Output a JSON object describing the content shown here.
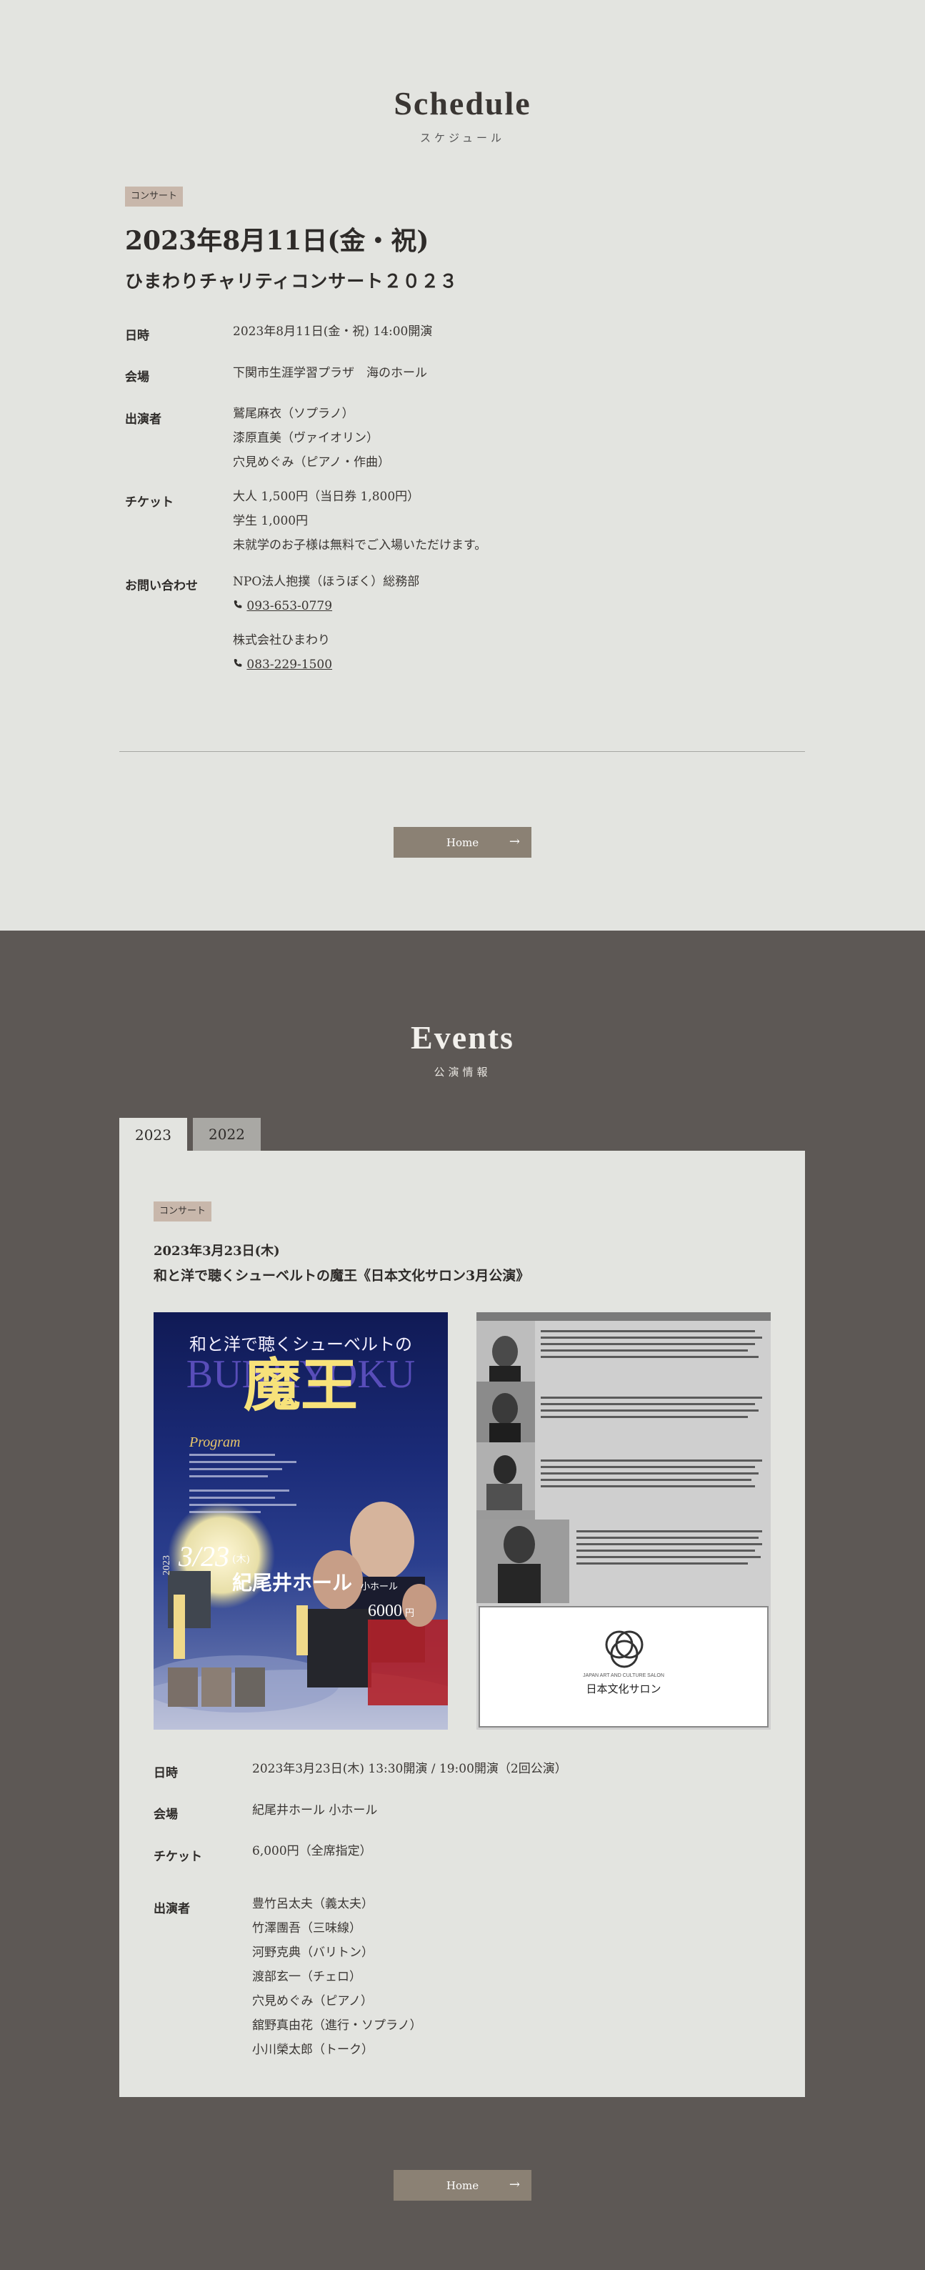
{
  "schedule": {
    "title": "Schedule",
    "subtitle": "スケジュール",
    "category": "コンサート",
    "date_heading": "2023年8月11日(金・祝)",
    "event_name": "ひまわりチャリティコンサート２０２３",
    "rows": {
      "datetime": {
        "label": "日時",
        "value": "2023年8月11日(金・祝) 14:00開演"
      },
      "venue": {
        "label": "会場",
        "value": "下関市生涯学習プラザ　海のホール"
      },
      "performers": {
        "label": "出演者",
        "lines": [
          "鷲尾麻衣（ソプラノ）",
          "漆原直美（ヴァイオリン）",
          "穴見めぐみ（ピアノ・作曲）"
        ]
      },
      "ticket": {
        "label": "チケット",
        "lines": [
          "大人 1,500円（当日券 1,800円）",
          "学生 1,000円",
          "未就学のお子様は無料でご入場いただけます。"
        ]
      },
      "contact": {
        "label": "お問い合わせ",
        "org1": "NPO法人抱撲（ほうぼく）総務部",
        "phone1": "093-653-0779",
        "org2": "株式会社ひまわり",
        "phone2": "083-229-1500"
      }
    },
    "home_button": "Home"
  },
  "events": {
    "title": "Events",
    "subtitle": "公演情報",
    "tabs": [
      "2023",
      "2022"
    ],
    "active_tab": "2023",
    "item": {
      "category": "コンサート",
      "date": "2023年3月23日(木)",
      "title": "和と洋で聴くシューベルトの魔王《日本文化サロン3月公演》",
      "poster": {
        "tagline": "和と洋で聴くシューベルトの",
        "main_title": "魔王",
        "overlay_latin": "BUNKYOKU",
        "program_label": "Program",
        "date": "3/23",
        "weekday": "(木)",
        "year": "2023",
        "hall": "紀尾井ホール",
        "hall_sub": "小ホール",
        "price": "6000",
        "price_unit": "円"
      },
      "flyer": {
        "logo_text": "日本文化サロン",
        "logo_sub": "JAPAN ART AND CULTURE SALON"
      },
      "rows": {
        "datetime": {
          "label": "日時",
          "value": "2023年3月23日(木) 13:30開演 / 19:00開演（2回公演）"
        },
        "venue": {
          "label": "会場",
          "value": "紀尾井ホール 小ホール"
        },
        "ticket": {
          "label": "チケット",
          "value": "6,000円（全席指定）"
        },
        "performers": {
          "label": "出演者",
          "lines": [
            "豊竹呂太夫（義太夫）",
            "竹澤團吾（三味線）",
            "河野克典（バリトン）",
            "渡部玄一（チェロ）",
            "穴見めぐみ（ピアノ）",
            "舘野真由花（進行・ソプラノ）",
            "小川榮太郎（トーク）"
          ]
        }
      }
    },
    "home_button": "Home"
  },
  "colors": {
    "schedule_bg": "#e3e4e0",
    "events_bg": "#5d5855",
    "tag_bg": "#c8b7ab",
    "button_bg": "#8b8174"
  }
}
